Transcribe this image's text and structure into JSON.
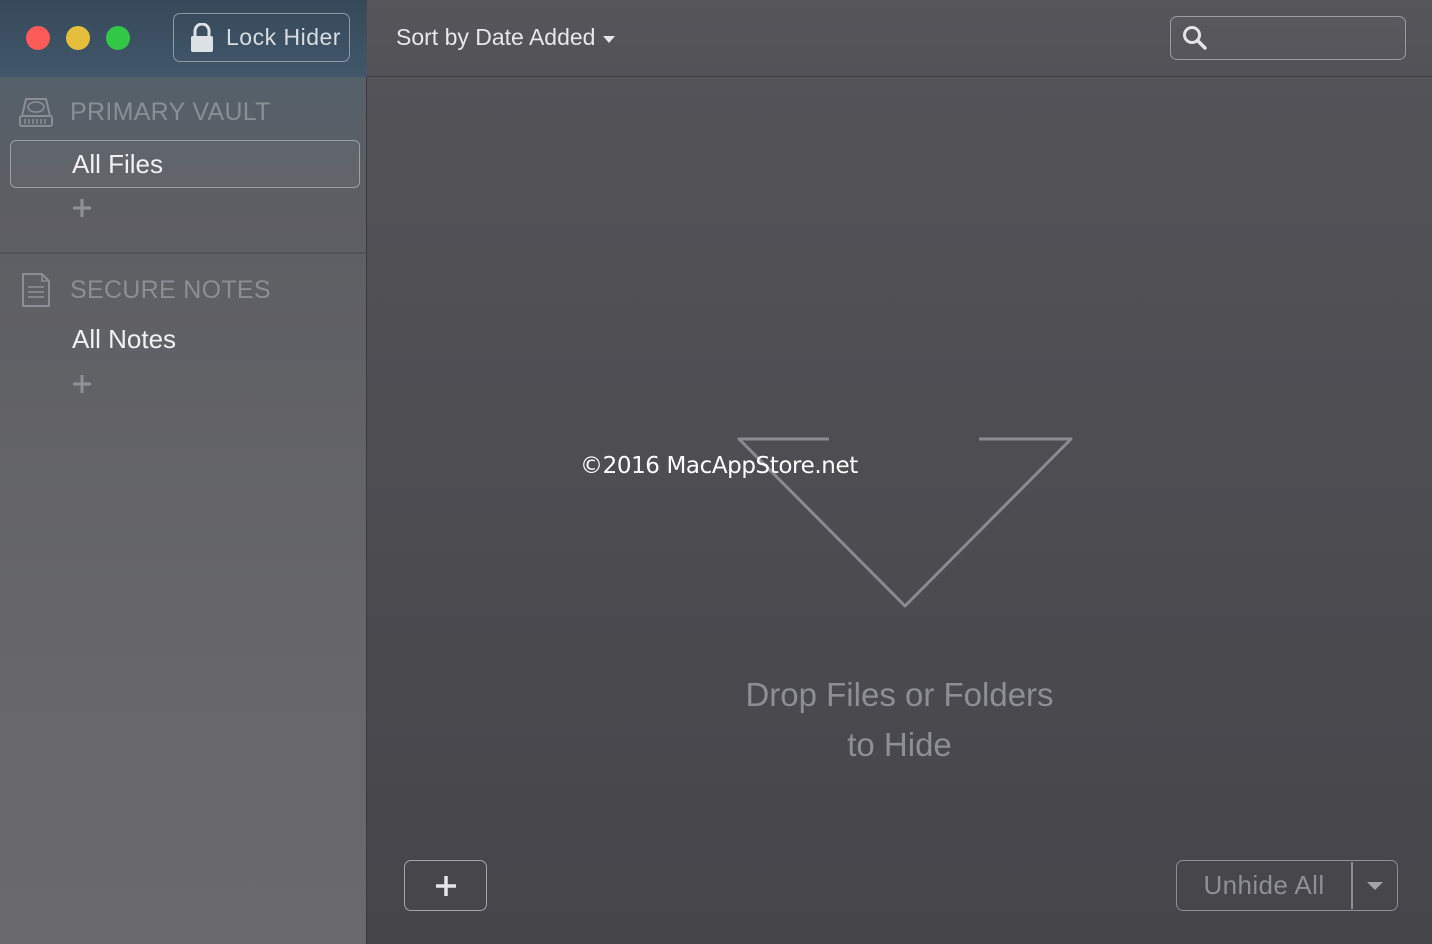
{
  "window": {
    "traffic_lights": [
      "close",
      "minimize",
      "zoom"
    ]
  },
  "sidebar": {
    "lock_button": {
      "label": "Lock Hider",
      "icon": "lock-icon"
    },
    "sections": [
      {
        "title": "PRIMARY VAULT",
        "icon": "hard-drive-icon",
        "items": [
          {
            "label": "All Files",
            "selected": true
          }
        ],
        "add_label": "+"
      },
      {
        "title": "SECURE NOTES",
        "icon": "note-icon",
        "items": [
          {
            "label": "All Notes",
            "selected": false
          }
        ],
        "add_label": "+"
      }
    ]
  },
  "toolbar": {
    "sort_label": "Sort by Date Added",
    "search": {
      "placeholder": "",
      "value": "",
      "icon": "search-icon"
    }
  },
  "main": {
    "drop_line1": "Drop Files or Folders",
    "drop_line2": "to Hide",
    "watermark": "©2016 MacAppStore.net",
    "add_button_label": "+",
    "unhide_label": "Unhide All"
  },
  "colors": {
    "close": "#fc5b57",
    "minimize": "#e5bf3c",
    "zoom": "#33c748"
  }
}
